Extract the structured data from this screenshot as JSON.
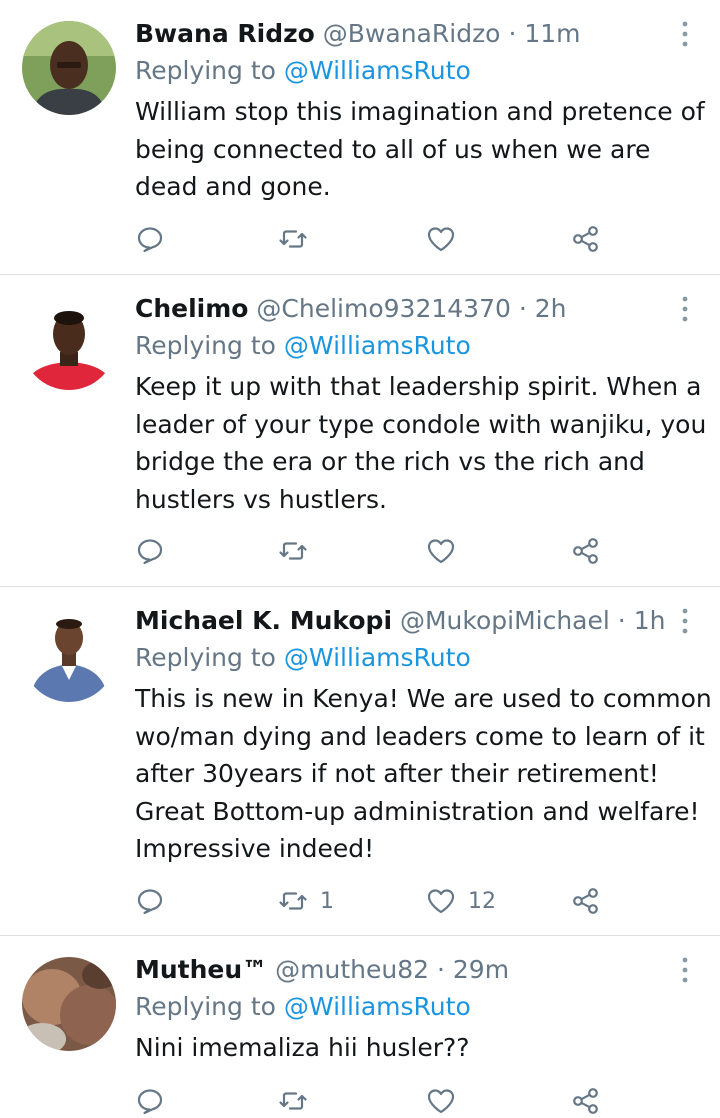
{
  "tweets": [
    {
      "name": "Bwana Ridzo",
      "handle": "@BwanaRidzo",
      "sep": "·",
      "time": "11m",
      "replying_label": "Replying to",
      "mention": "@WilliamsRuto",
      "lines": [
        "William stop this imagination and pretence of",
        "being connected to all of us when we are",
        "dead and gone."
      ],
      "retweets": "",
      "likes": "",
      "avatar": "man-green-background"
    },
    {
      "name": "Chelimo",
      "handle": "@Chelimo93214370",
      "sep": "·",
      "time": "2h",
      "replying_label": "Replying to",
      "mention": "@WilliamsRuto",
      "lines": [
        "Keep it up with that leadership spirit. When a",
        "leader of your type condole with wanjiku, you",
        "bridge the era or the rich vs the rich and",
        "hustlers vs hustlers."
      ],
      "retweets": "",
      "likes": "",
      "avatar": "man-red-shirt"
    },
    {
      "name": "Michael K. Mukopi",
      "handle": "@MukopiMichael",
      "sep": "·",
      "time": "1h",
      "replying_label": "Replying to",
      "mention": "@WilliamsRuto",
      "lines": [
        "This is new in Kenya! We are used to common",
        "wo/man dying and leaders come to learn of it",
        "after 30years if not after their retirement!",
        "Great Bottom-up administration and welfare!",
        "Impressive indeed!"
      ],
      "retweets": "1",
      "likes": "12",
      "avatar": "man-blue-shirt"
    },
    {
      "name": "Mutheu™",
      "handle": "@mutheu82",
      "sep": "·",
      "time": "29m",
      "replying_label": "Replying to",
      "mention": "@WilliamsRuto",
      "lines": [
        "Nini imemaliza hii husler??"
      ],
      "retweets": "",
      "likes": "",
      "avatar": "blurred-photo"
    }
  ],
  "colors": {
    "link": "#1b95e0",
    "muted": "#657786",
    "text": "#14171a",
    "divider": "#dcdfe2"
  },
  "icons": [
    "reply-icon",
    "retweet-icon",
    "like-icon",
    "share-icon",
    "more-options-icon"
  ]
}
